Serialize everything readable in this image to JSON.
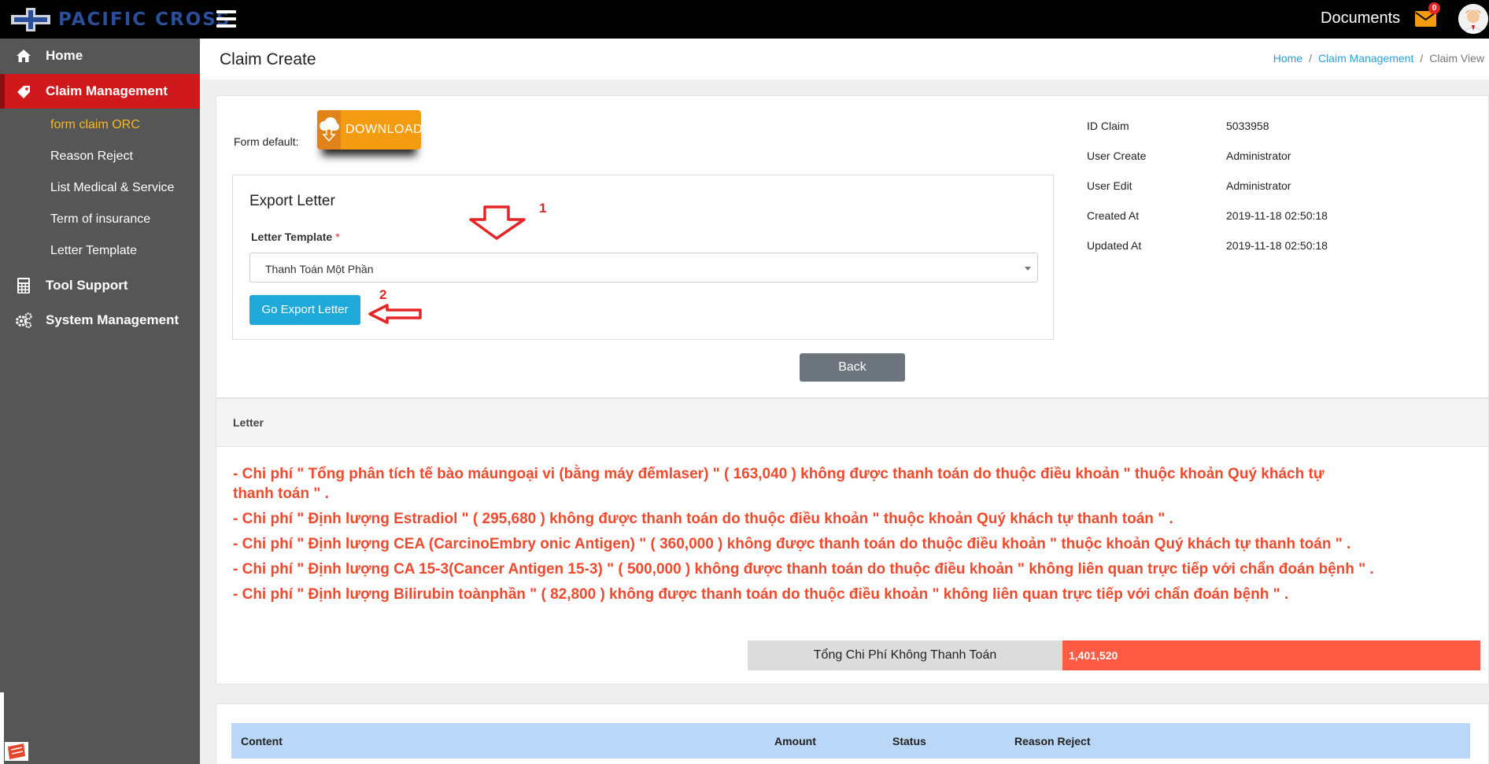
{
  "brand": {
    "name": "PACIFIC CROSS"
  },
  "header": {
    "documents_label": "Documents",
    "mail_count": "0"
  },
  "sidebar": {
    "items": [
      {
        "label": "Home",
        "icon": "home-icon"
      },
      {
        "label": "Claim Management",
        "icon": "tag-icon"
      },
      {
        "label": "Tool Support",
        "icon": "calculator-icon"
      },
      {
        "label": "System Management",
        "icon": "gears-icon"
      }
    ],
    "sub_items": [
      {
        "label": "form claim ORC"
      },
      {
        "label": "Reason Reject"
      },
      {
        "label": "List Medical & Service"
      },
      {
        "label": "Term of insurance"
      },
      {
        "label": "Letter Template"
      }
    ]
  },
  "page": {
    "title": "Claim Create",
    "breadcrumb": [
      "Home",
      "Claim Management",
      "Claim View"
    ]
  },
  "form_default": {
    "label": "Form default:",
    "download_label": "DOWNLOAD"
  },
  "export": {
    "title": "Export Letter",
    "template_label": "Letter Template",
    "required_mark": "*",
    "selected_template": "Thanh Toán Một Phần",
    "go_button": "Go Export Letter",
    "annotation_1": "1",
    "annotation_2": "2"
  },
  "back_button": "Back",
  "claim_info": [
    {
      "label": "ID Claim",
      "value": "5033958"
    },
    {
      "label": "User Create",
      "value": "Administrator"
    },
    {
      "label": "User Edit",
      "value": "Administrator"
    },
    {
      "label": "Created At",
      "value": "2019-11-18 02:50:18"
    },
    {
      "label": "Updated At",
      "value": "2019-11-18 02:50:18"
    }
  ],
  "letter": {
    "header": "Letter",
    "lines": [
      "- Chi phí \" Tổng phân tích tế bào máungoại vi (bằng máy đếmlaser) \" ( 163,040 ) không được thanh toán do thuộc điều khoản \" thuộc khoản Quý khách tự thanh toán \" .",
      "- Chi phí \" Định lượng Estradiol \" ( 295,680 ) không được thanh toán do thuộc điều khoản \" thuộc khoản Quý khách tự thanh toán \" .",
      "- Chi phí \" Định lượng CEA (CarcinoEmbry onic Antigen) \" ( 360,000 ) không được thanh toán do thuộc điều khoản \" thuộc khoản Quý khách tự thanh toán \" .",
      "- Chi phí \" Định lượng CA 15-3(Cancer Antigen 15-3) \" ( 500,000 ) không được thanh toán do thuộc điều khoản \" không liên quan trực tiếp với chẩn đoán bệnh \" .",
      "- Chi phí \" Định lượng Bilirubin toànphần \" ( 82,800 ) không được thanh toán do thuộc điều khoản \" không liên quan trực tiếp với chẩn đoán bệnh \" ."
    ],
    "total_label": "Tổng Chi Phí Không Thanh Toán",
    "total_value": "1,401,520"
  },
  "table": {
    "columns": [
      "Content",
      "Amount",
      "Status",
      "Reason Reject"
    ]
  },
  "colors": {
    "topbar": "#000000",
    "sidebar": "#565656",
    "active": "#d0191c",
    "submenu_current": "#f5b72c",
    "primary_button": "#1fa9d9",
    "letter_text": "#ef4a2d",
    "total_value_bg": "#ff5a44",
    "table_header": "#bad7f8"
  }
}
